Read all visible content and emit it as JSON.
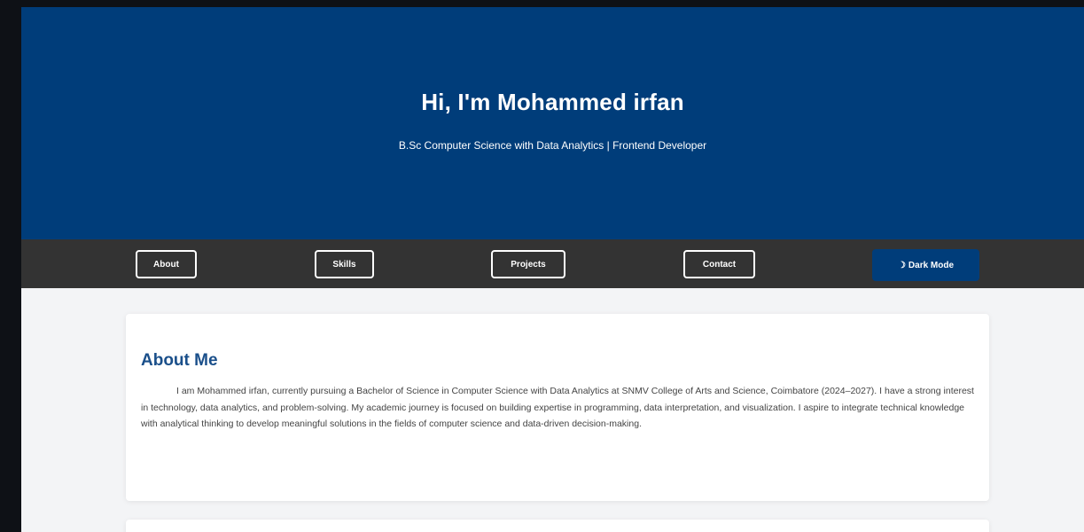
{
  "hero": {
    "title": "Hi, I'm Mohammed irfan",
    "subtitle": "B.Sc Computer Science with Data Analytics | Frontend Developer"
  },
  "nav": {
    "items": [
      {
        "label": "About"
      },
      {
        "label": "Skills"
      },
      {
        "label": "Projects"
      },
      {
        "label": "Contact"
      }
    ],
    "dark_mode": {
      "icon": "moon-icon",
      "label": "Dark Mode"
    }
  },
  "about": {
    "heading": "About Me",
    "body": "I am Mohammed irfan, currently pursuing a Bachelor of Science in Computer Science with Data Analytics at SNMV College of Arts and Science, Coimbatore (2024–2027). I have a strong interest in technology, data analytics, and problem-solving. My academic journey is focused on building expertise in programming, data interpretation, and visualization. I aspire to integrate technical knowledge with analytical thinking to develop meaningful solutions in the fields of computer science and data-driven decision-making."
  },
  "colors": {
    "primary": "#003d7a",
    "nav_bg": "#333333",
    "heading": "#1a4f8a",
    "page_bg": "#f3f4f6"
  }
}
